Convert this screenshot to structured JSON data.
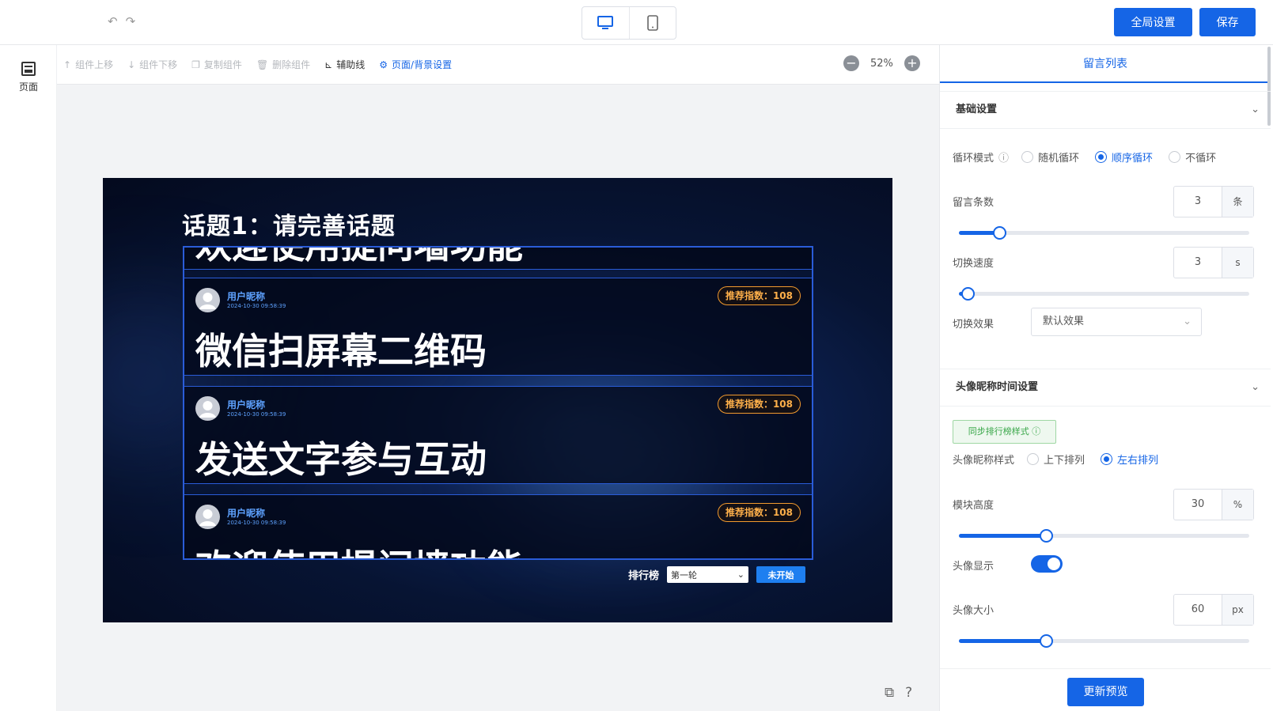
{
  "topbar": {
    "global_settings_label": "全局设置",
    "save_label": "保存"
  },
  "left_rail": {
    "page_label": "页面"
  },
  "toolbar": {
    "tools": [
      {
        "label": "组件上移",
        "enabled": false
      },
      {
        "label": "组件下移",
        "enabled": false
      },
      {
        "label": "复制组件",
        "enabled": false
      },
      {
        "label": "删除组件",
        "enabled": false
      },
      {
        "label": "辅助线",
        "enabled": true
      },
      {
        "label": "页面/背景设置",
        "enabled": true
      }
    ],
    "zoom": "52%"
  },
  "preview": {
    "title": "话题1：请完善话题",
    "top_partial_text": "欢迎使用提问墙功能",
    "cards": [
      {
        "nick": "用户昵称",
        "time": "2024-10-30 09:58:39",
        "score": "推荐指数：108",
        "message": "微信扫屏幕二维码"
      },
      {
        "nick": "用户昵称",
        "time": "2024-10-30 09:58:39",
        "score": "推荐指数：108",
        "message": "发送文字参与互动"
      },
      {
        "nick": "用户昵称",
        "time": "2024-10-30 09:58:39",
        "score": "推荐指数：108",
        "message": "欢迎使用提问墙功能"
      }
    ],
    "ranking_label": "排行榜",
    "round_select": "第一轮",
    "start_button": "未开始"
  },
  "panel": {
    "tab": "留言列表",
    "basic_section": "基础设置",
    "loop_mode_label": "循环模式",
    "loop_options": [
      {
        "label": "随机循环",
        "selected": false
      },
      {
        "label": "顺序循环",
        "selected": true
      },
      {
        "label": "不循环",
        "selected": false
      }
    ],
    "message_count": {
      "label": "留言条数",
      "value": "3",
      "unit": "条",
      "fraction": 0.14
    },
    "switch_speed": {
      "label": "切换速度",
      "value": "3",
      "unit": "s",
      "fraction": 0.03
    },
    "switch_effect": {
      "label": "切换效果",
      "value": "默认效果"
    },
    "avatar_section": "头像昵称时间设置",
    "sync_badge": "同步排行榜样式",
    "avatar_style_label": "头像昵称样式",
    "avatar_style_options": [
      {
        "label": "上下排列",
        "selected": false
      },
      {
        "label": "左右排列",
        "selected": true
      }
    ],
    "module_height": {
      "label": "模块高度",
      "value": "30",
      "unit": "%",
      "fraction": 0.3
    },
    "avatar_display": {
      "label": "头像显示",
      "on": true
    },
    "avatar_size": {
      "label": "头像大小",
      "value": "60",
      "unit": "px",
      "fraction": 0.3
    },
    "update_preview": "更新预览"
  }
}
